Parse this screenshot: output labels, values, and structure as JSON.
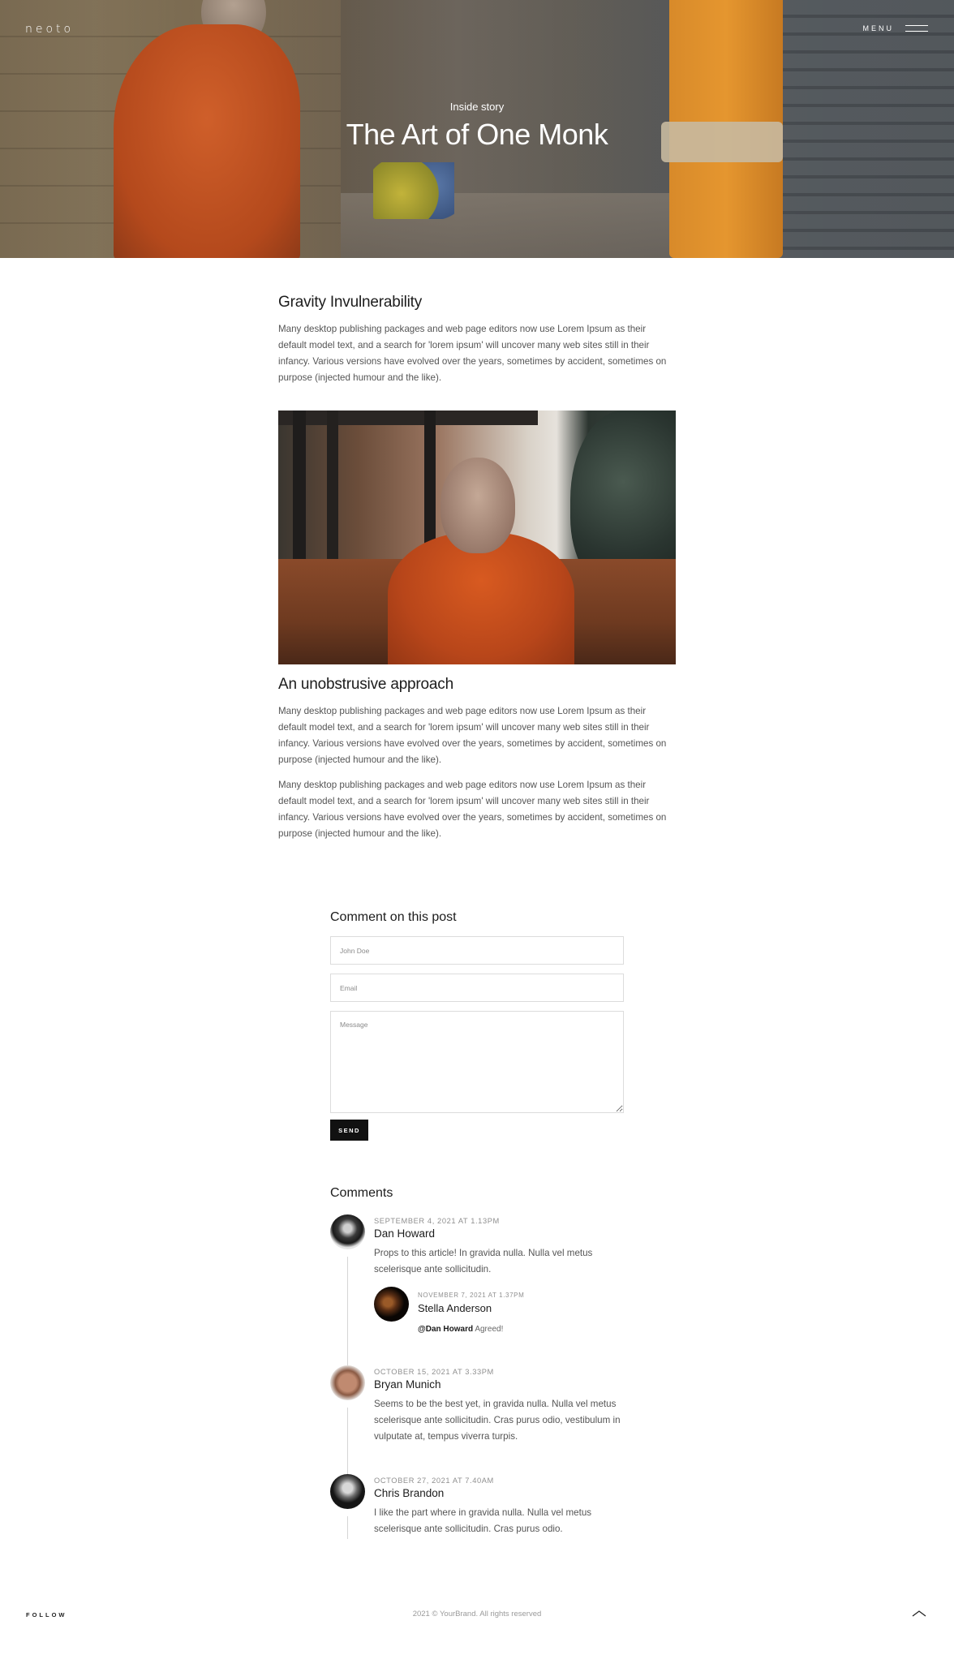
{
  "nav": {
    "logo": "neoto",
    "menu_label": "MENU",
    "menu_icon": "hamburger-icon"
  },
  "hero": {
    "eyebrow": "Inside story",
    "title": "The Art of One Monk"
  },
  "article": {
    "sections": [
      {
        "heading": "Gravity Invulnerability",
        "paragraphs": [
          "Many desktop publishing packages and web page editors now use Lorem Ipsum as their default model text, and a search for 'lorem ipsum' will uncover many web sites still in their infancy. Various versions have evolved over the years, sometimes by accident, sometimes on purpose (injected humour and the like)."
        ]
      },
      {
        "heading": "An unobstrusive approach",
        "paragraphs": [
          "Many desktop publishing packages and web page editors now use Lorem Ipsum as their default model text, and a search for 'lorem ipsum' will uncover many web sites still in their infancy. Various versions have evolved over the years, sometimes by accident, sometimes on purpose (injected humour and the like).",
          "Many desktop publishing packages and web page editors now use Lorem Ipsum as their default model text, and a search for 'lorem ipsum' will uncover many web sites still in their infancy. Various versions have evolved over the years, sometimes by accident, sometimes on purpose (injected humour and the like)."
        ]
      }
    ],
    "image_alt": "Elderly monk in orange robe"
  },
  "comment_form": {
    "title": "Comment on this post",
    "name_placeholder": "John Doe",
    "email_placeholder": "Email",
    "message_placeholder": "Message",
    "name_value": "",
    "email_value": "",
    "message_value": "",
    "send_label": "SEND"
  },
  "comments": {
    "title": "Comments",
    "items": [
      {
        "date": "SEPTEMBER 4, 2021 AT 1.13PM",
        "author": "Dan Howard",
        "body": "Props to this article! In gravida nulla. Nulla vel metus scelerisque ante sollicitudin.",
        "replies": [
          {
            "date": "NOVEMBER 7, 2021 AT 1.37PM",
            "author": "Stella Anderson",
            "mention": "@Dan Howard",
            "body": "Agreed!"
          }
        ]
      },
      {
        "date": "OCTOBER 15, 2021 AT 3.33PM",
        "author": "Bryan Munich",
        "body": "Seems to be the best yet, in gravida nulla. Nulla vel metus scelerisque ante sollicitudin. Cras purus odio, vestibulum in vulputate at, tempus viverra turpis.",
        "replies": []
      },
      {
        "date": "OCTOBER 27, 2021 AT 7.40AM",
        "author": "Chris Brandon",
        "body": "I like the part where in gravida nulla. Nulla vel metus scelerisque ante sollicitudin. Cras purus odio.",
        "replies": []
      }
    ]
  },
  "footer": {
    "follow_label": "FOLLOW",
    "copyright": "2021 © YourBrand. All rights reserved",
    "to_top_icon": "chevron-up-icon"
  }
}
